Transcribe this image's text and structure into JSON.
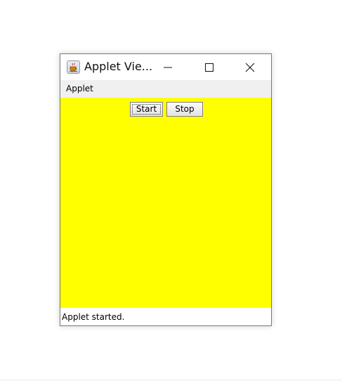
{
  "window": {
    "title": "Applet Vie...",
    "icon": "java-coffee-cup-icon"
  },
  "title_buttons": {
    "minimize": "minimize-icon",
    "maximize": "maximize-icon",
    "close": "close-icon"
  },
  "menubar": {
    "items": [
      {
        "label": "Applet"
      }
    ]
  },
  "applet": {
    "background": "#ffff00",
    "buttons": {
      "start_label": "Start",
      "stop_label": "Stop"
    }
  },
  "status": {
    "text": "Applet started."
  }
}
